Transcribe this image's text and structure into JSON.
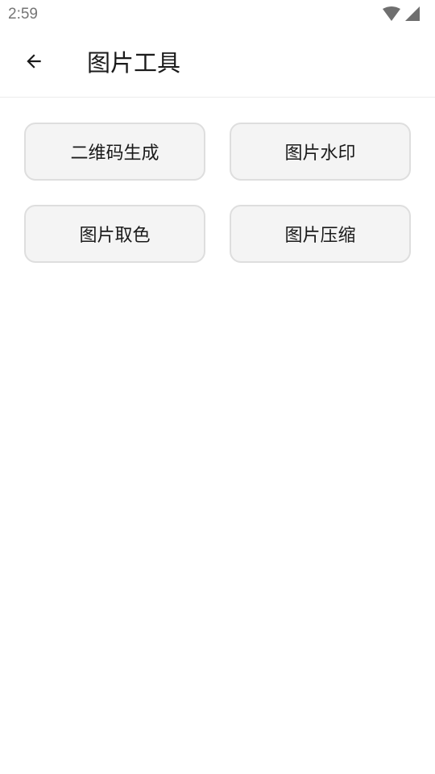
{
  "status_bar": {
    "time": "2:59",
    "icons": [
      "wifi-icon",
      "cellular-signal-icon"
    ]
  },
  "toolbar": {
    "back_icon": "arrow-back-icon",
    "title": "图片工具"
  },
  "tools": [
    {
      "label": "二维码生成"
    },
    {
      "label": "图片水印"
    },
    {
      "label": "图片取色"
    },
    {
      "label": "图片压缩"
    }
  ],
  "colors": {
    "background": "#ffffff",
    "button_fill": "#f4f4f4",
    "button_border": "#dedede",
    "text": "#1a1a1a",
    "status_text": "#757575"
  }
}
